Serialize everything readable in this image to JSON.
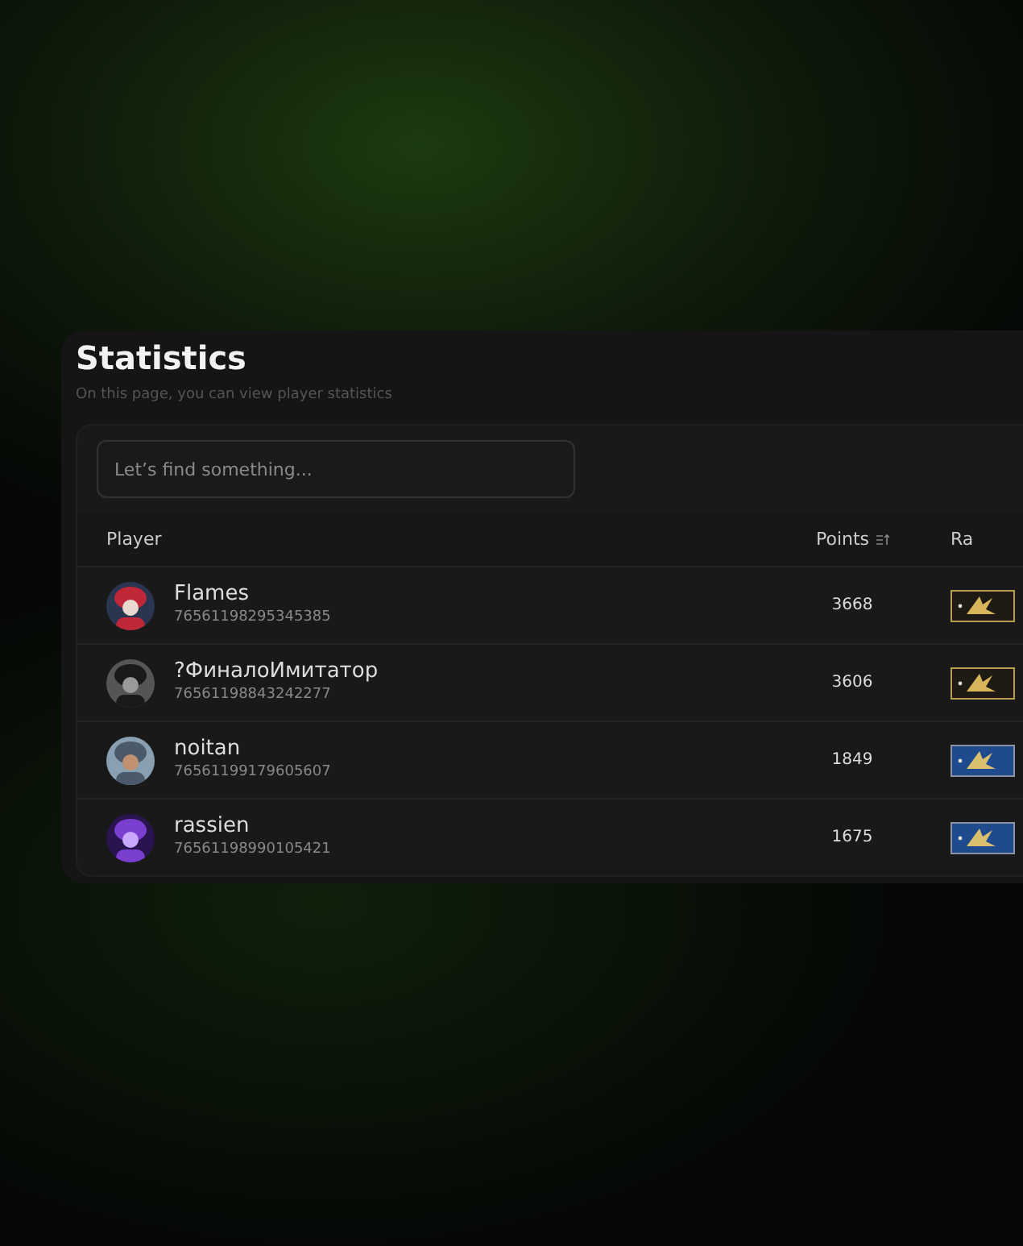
{
  "title": "Statistics",
  "subtitle": "On this page, you can view player statistics",
  "search": {
    "placeholder": "Let’s find something..."
  },
  "columns": [
    {
      "label": "Player"
    },
    {
      "label": "Points",
      "sortable": true
    },
    {
      "label": "Ra"
    }
  ],
  "rows": [
    {
      "name": "Flames",
      "steam_id": "76561198295345385",
      "points": "3668",
      "rank": {
        "kind": "gold"
      }
    },
    {
      "name": "?ФиналоИмитатор",
      "steam_id": "76561198843242277",
      "points": "3606",
      "rank": {
        "kind": "gold"
      }
    },
    {
      "name": "noitan",
      "steam_id": "76561199179605607",
      "points": "1849",
      "rank": {
        "kind": "blue"
      }
    },
    {
      "name": "rassien",
      "steam_id": "76561198990105421",
      "points": "1675",
      "rank": {
        "kind": "blue"
      }
    }
  ]
}
